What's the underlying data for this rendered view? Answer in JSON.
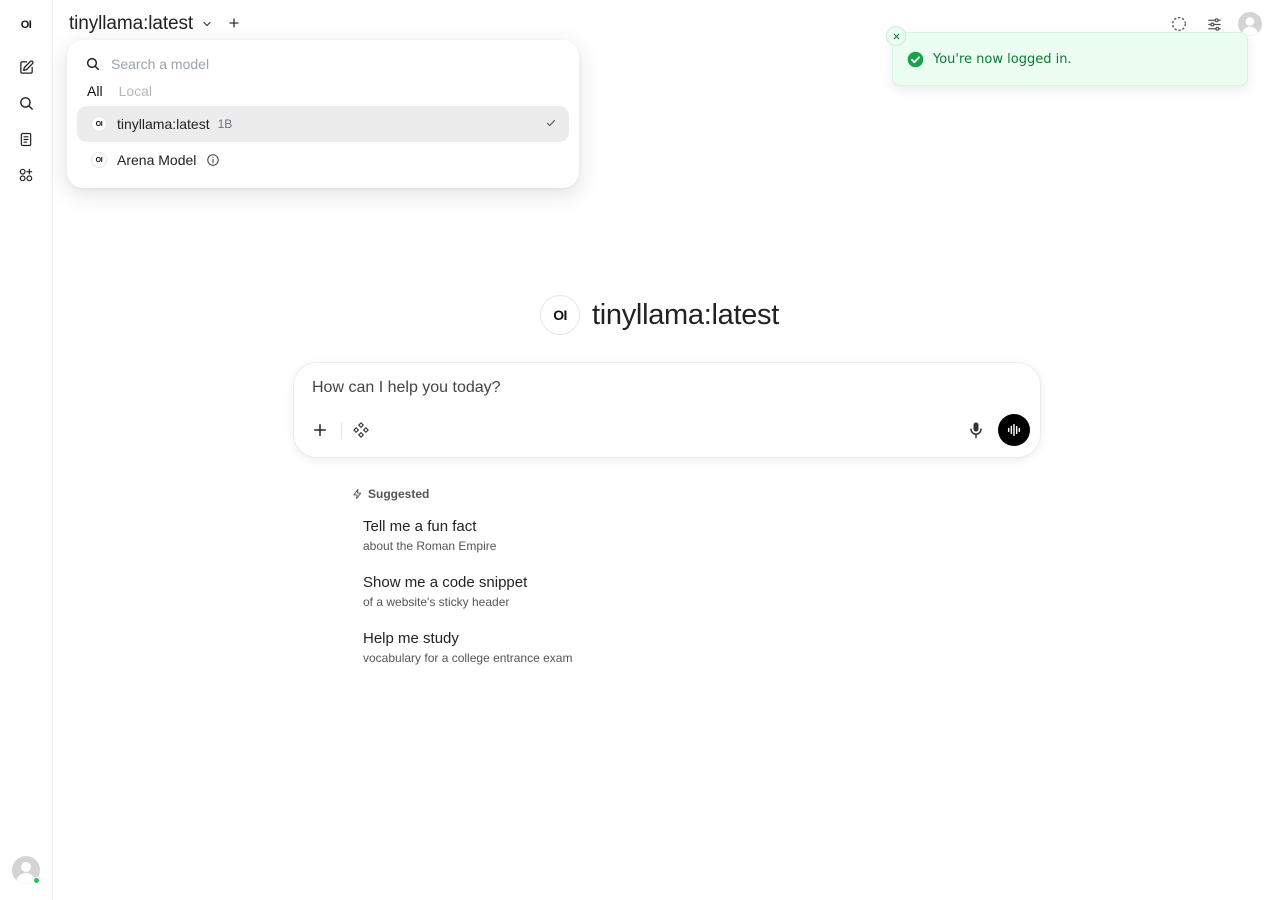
{
  "sidebar": {
    "logo_text": "OI",
    "items": [
      {
        "icon": "new-chat-icon"
      },
      {
        "icon": "search-icon"
      },
      {
        "icon": "notes-icon"
      },
      {
        "icon": "workspace-icon"
      }
    ],
    "user_status_color": "#22c55e"
  },
  "header": {
    "model_name": "tinyllama:latest",
    "icons": [
      "chevron-down-icon",
      "plus-icon",
      "controls-icon",
      "settings-icon",
      "avatar"
    ]
  },
  "model_dropdown": {
    "search_placeholder": "Search a model",
    "tabs": [
      "All",
      "Local"
    ],
    "active_tab": "All",
    "items": [
      {
        "logo": "OI",
        "name": "tinyllama:latest",
        "tag": "1B",
        "selected": true
      },
      {
        "logo": "OI",
        "name": "Arena Model",
        "tag": "",
        "selected": false
      }
    ]
  },
  "toast": {
    "message": "You're now logged in.",
    "status_color": "#16a34a"
  },
  "hero": {
    "logo_text": "OI",
    "title": "tinyllama:latest"
  },
  "composer": {
    "placeholder": "How can I help you today?",
    "value": ""
  },
  "suggestions": {
    "heading": "Suggested",
    "items": [
      {
        "title": "Tell me a fun fact",
        "subtitle": "about the Roman Empire"
      },
      {
        "title": "Show me a code snippet",
        "subtitle": "of a website's sticky header"
      },
      {
        "title": "Help me study",
        "subtitle": "vocabulary for a college entrance exam"
      }
    ]
  }
}
